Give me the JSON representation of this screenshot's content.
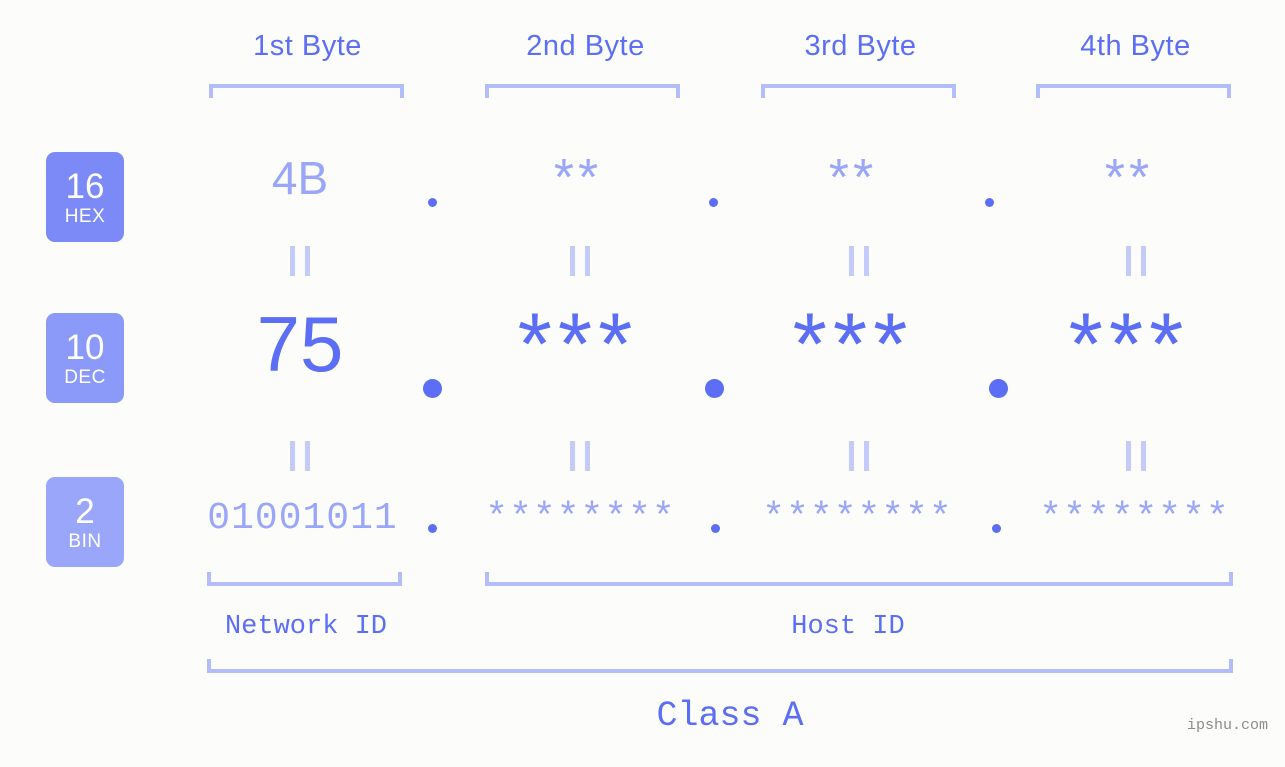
{
  "meta": {
    "background": "#fcfdfa",
    "accent_strong": "#5b6ef5",
    "accent_light": "#99a6f9",
    "bracket_color": "#b3bdfb",
    "equals_color": "#c3cbfb"
  },
  "byte_headers": [
    {
      "label": "1st Byte"
    },
    {
      "label": "2nd Byte"
    },
    {
      "label": "3rd Byte"
    },
    {
      "label": "4th Byte"
    }
  ],
  "bases": [
    {
      "num": "16",
      "label": "HEX",
      "color": "#7b8af7"
    },
    {
      "num": "10",
      "label": "DEC",
      "color": "#8b99f8"
    },
    {
      "num": "2",
      "label": "BIN",
      "color": "#99a6f9"
    }
  ],
  "rows": {
    "hex": {
      "values": [
        "4B",
        "**",
        "**",
        "**"
      ]
    },
    "dec": {
      "values": [
        "75",
        "***",
        "***",
        "***"
      ]
    },
    "bin": {
      "values": [
        "01001011",
        "********",
        "********",
        "********"
      ]
    }
  },
  "separators": {
    "dot": ".",
    "equals": "||"
  },
  "sections": [
    {
      "label": "Network ID"
    },
    {
      "label": "Host ID"
    }
  ],
  "class_label": "Class A",
  "watermark": "ipshu.com"
}
